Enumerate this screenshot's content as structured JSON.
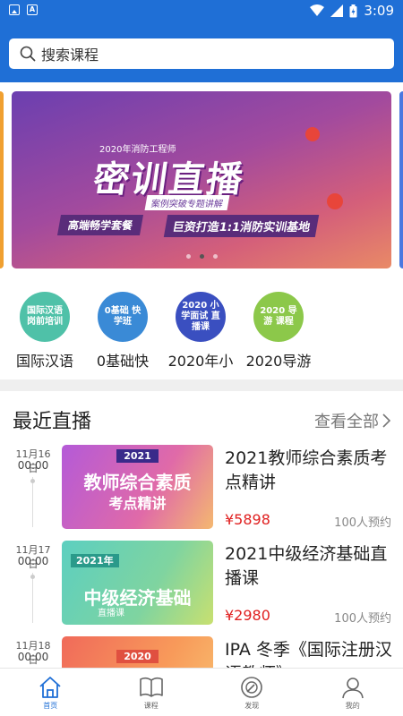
{
  "status_bar": {
    "time": "3:09"
  },
  "search": {
    "placeholder": "搜索课程"
  },
  "banner": {
    "small_title": "2020年消防工程师",
    "big_title": "密训直播",
    "subtitle": "案例突破专题讲解",
    "tag": "高端畅学套餐",
    "slogan": "巨资打造1:1消防实训基地",
    "page_count": 3,
    "active_page": 2
  },
  "categories": [
    {
      "label": "国际汉语",
      "icon_text": "国际汉语 岗前培训",
      "color": "#4fc1a8"
    },
    {
      "label": "0基础快",
      "icon_text": "0基础 快学班",
      "color": "#3a8ad6"
    },
    {
      "label": "2020年小",
      "icon_text": "2020 小学面试 直播课",
      "color": "#3a4fc0"
    },
    {
      "label": "2020导游",
      "icon_text": "2020 导游 课程",
      "color": "#8cc84a"
    }
  ],
  "live_section": {
    "title": "最近直播",
    "more": "查看全部",
    "items": [
      {
        "date": "11月16日",
        "time": "00:00",
        "title": "2021教师综合素质考点精讲",
        "price": "¥5898",
        "count": "100人预约",
        "thumb_year": "2021",
        "thumb_title": "教师综合素质",
        "thumb_sub": "考点精讲"
      },
      {
        "date": "11月17日",
        "time": "00:00",
        "title": "2021中级经济基础直播课",
        "price": "¥2980",
        "count": "100人预约",
        "thumb_year": "2021年",
        "thumb_title": "中级经济基础",
        "thumb_sub": "直播课"
      },
      {
        "date": "11月18日",
        "time": "00:00",
        "title": "IPA 冬季《国际注册汉语教师》",
        "price": "",
        "count": "",
        "thumb_year": "2020",
        "thumb_title": "",
        "thumb_sub": ""
      }
    ]
  },
  "tabs": [
    {
      "label": "首页",
      "icon": "home-icon",
      "active": true
    },
    {
      "label": "课程",
      "icon": "book-icon",
      "active": false
    },
    {
      "label": "发现",
      "icon": "compass-icon",
      "active": false
    },
    {
      "label": "我的",
      "icon": "user-icon",
      "active": false
    }
  ],
  "colors": {
    "primary": "#1f6fd6",
    "price": "#e02020"
  }
}
